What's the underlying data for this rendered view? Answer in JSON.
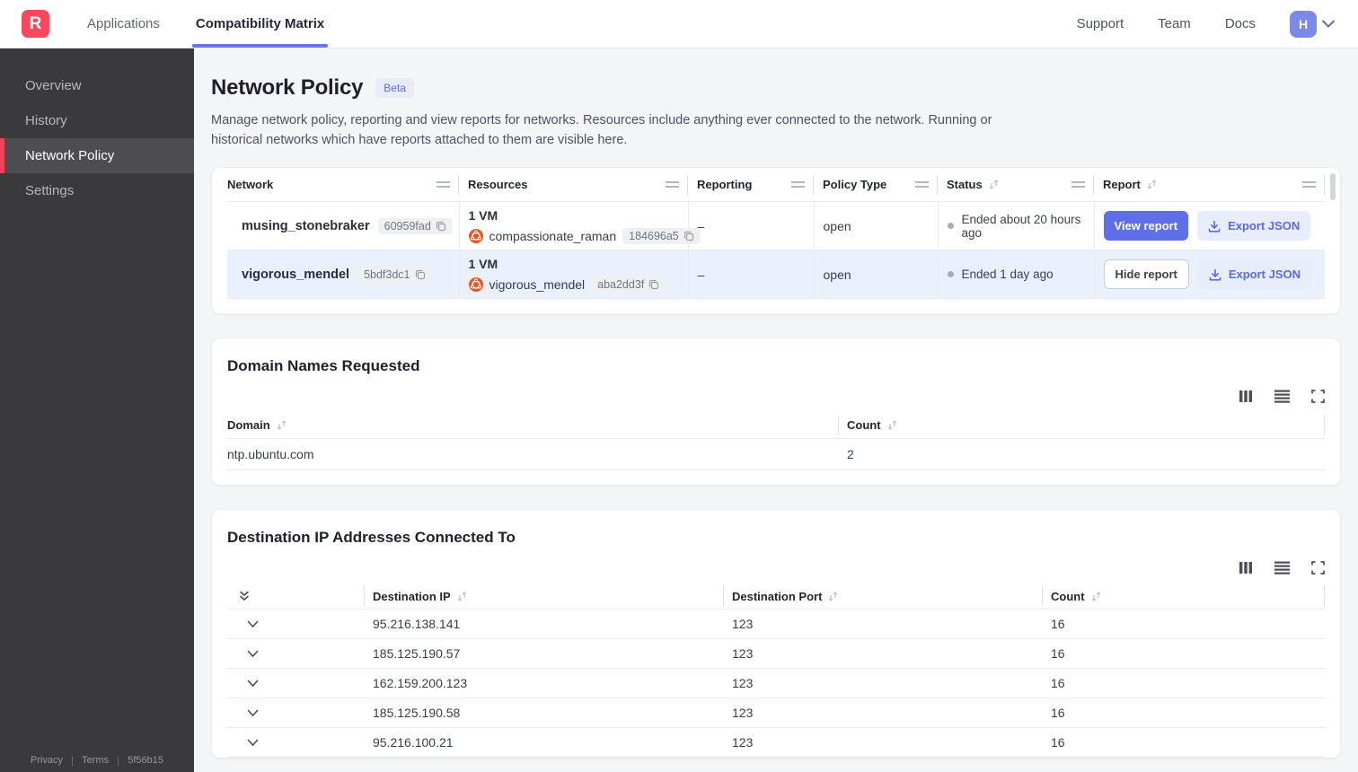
{
  "navbar": {
    "logo_letter": "R",
    "tabs": [
      {
        "label": "Applications"
      },
      {
        "label": "Compatibility Matrix"
      }
    ],
    "links": [
      {
        "label": "Support"
      },
      {
        "label": "Team"
      },
      {
        "label": "Docs"
      }
    ],
    "avatar_initial": "H"
  },
  "sidebar": {
    "items": [
      {
        "label": "Overview"
      },
      {
        "label": "History"
      },
      {
        "label": "Network Policy"
      },
      {
        "label": "Settings"
      }
    ],
    "footer": {
      "privacy": "Privacy",
      "terms": "Terms",
      "build": "5f56b15"
    }
  },
  "page": {
    "title": "Network Policy",
    "beta": "Beta",
    "description": "Manage network policy, reporting and view reports for networks. Resources include anything ever connected to the network. Running or historical networks which have reports attached to them are visible here."
  },
  "networks_table": {
    "headers": {
      "network": "Network",
      "resources": "Resources",
      "reporting": "Reporting",
      "policy_type": "Policy Type",
      "status": "Status",
      "report": "Report"
    },
    "rows": [
      {
        "name": "musing_stonebraker",
        "id": "60959fad",
        "vm_summary": "1 VM",
        "resource_name": "compassionate_raman",
        "resource_id": "184696a5",
        "reporting": "–",
        "policy_type": "open",
        "status": "Ended about 20 hours ago",
        "report_action": "View report",
        "export_action": "Export JSON"
      },
      {
        "name": "vigorous_mendel",
        "id": "5bdf3dc1",
        "vm_summary": "1 VM",
        "resource_name": "vigorous_mendel",
        "resource_id": "aba2dd3f",
        "reporting": "–",
        "policy_type": "open",
        "status": "Ended 1 day ago",
        "report_action": "Hide report",
        "export_action": "Export JSON"
      }
    ]
  },
  "domains_card": {
    "title": "Domain Names Requested",
    "headers": {
      "domain": "Domain",
      "count": "Count"
    },
    "rows": [
      {
        "domain": "ntp.ubuntu.com",
        "count": "2"
      }
    ]
  },
  "destinations_card": {
    "title": "Destination IP Addresses Connected To",
    "headers": {
      "ip": "Destination IP",
      "port": "Destination Port",
      "count": "Count"
    },
    "rows": [
      {
        "ip": "95.216.138.141",
        "port": "123",
        "count": "16"
      },
      {
        "ip": "185.125.190.57",
        "port": "123",
        "count": "16"
      },
      {
        "ip": "162.159.200.123",
        "port": "123",
        "count": "16"
      },
      {
        "ip": "185.125.190.58",
        "port": "123",
        "count": "16"
      },
      {
        "ip": "95.216.100.21",
        "port": "123",
        "count": "16"
      }
    ]
  },
  "colors": {
    "accent_purple": "#5f6fe8",
    "logo_red": "#f9485b",
    "row_highlight": "#eaf1fd",
    "sidebar_bg": "#3a3a3c",
    "resource_icon_orange": "#e95420"
  }
}
